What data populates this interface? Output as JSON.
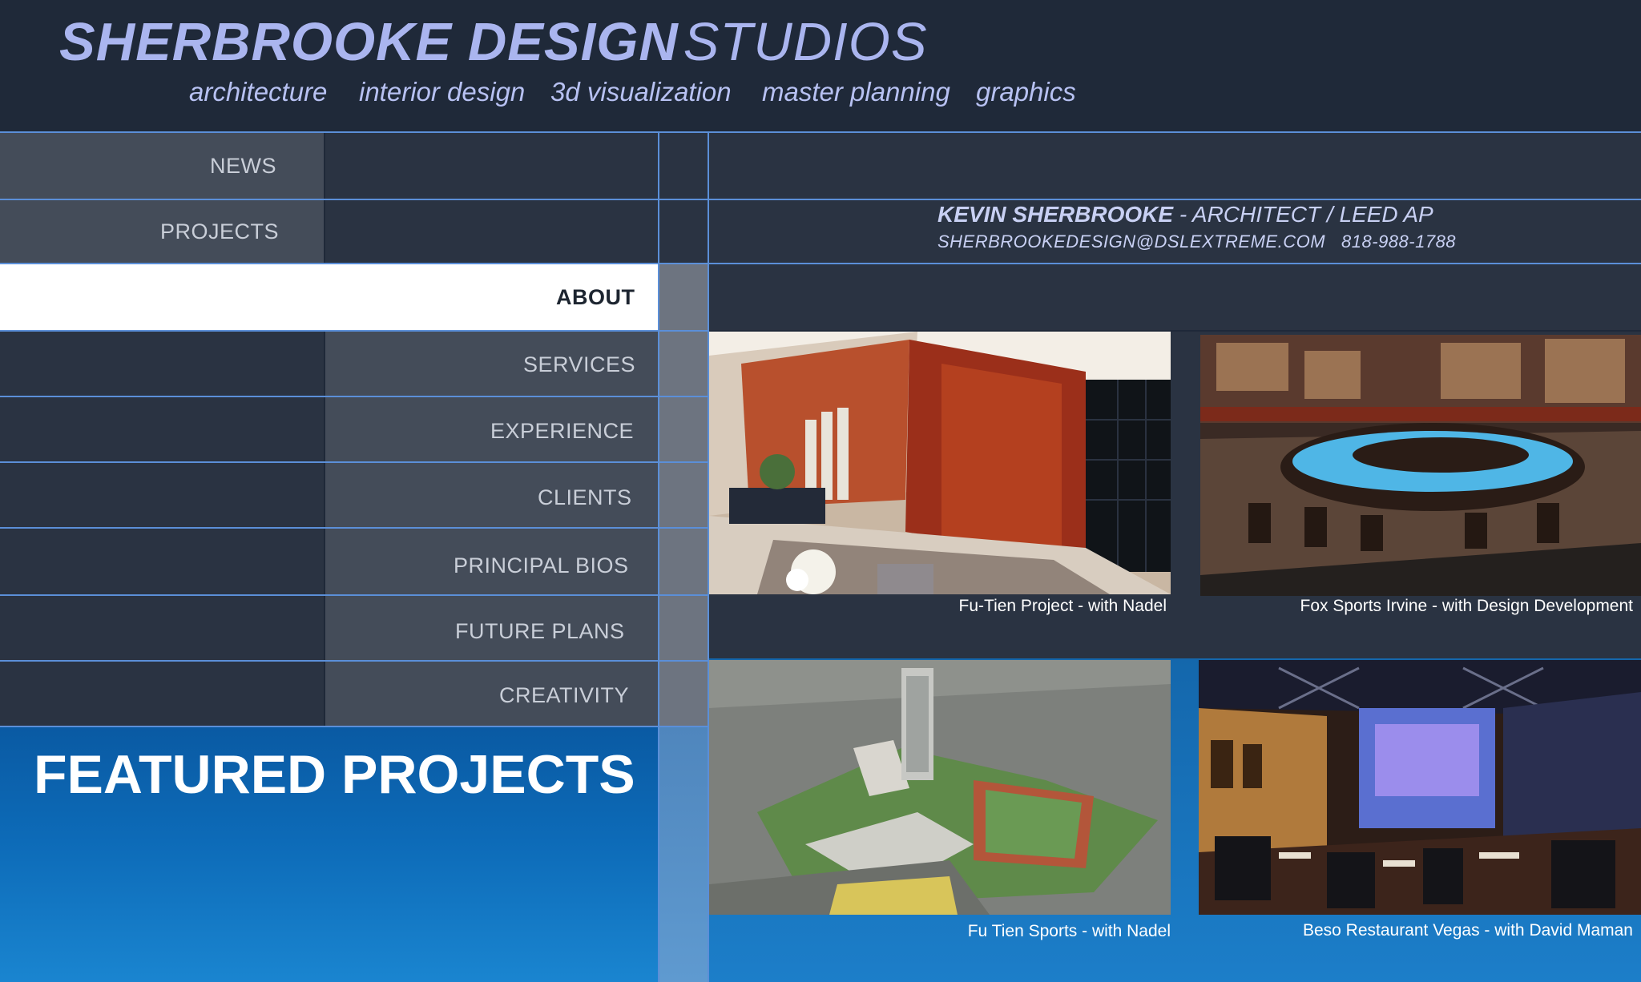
{
  "header": {
    "brand_bold": "SHERBROOKE DESIGN",
    "brand_light": "STUDIOS",
    "services": [
      "architecture",
      "interior design",
      "3d visualization",
      "master planning",
      "graphics"
    ]
  },
  "nav": {
    "items": [
      {
        "label": "NEWS"
      },
      {
        "label": "PROJECTS"
      },
      {
        "label": "ABOUT",
        "active": true
      },
      {
        "label": "SERVICES"
      },
      {
        "label": "EXPERIENCE"
      },
      {
        "label": "CLIENTS"
      },
      {
        "label": "PRINCIPAL BIOS"
      },
      {
        "label": "FUTURE PLANS"
      },
      {
        "label": "CREATIVITY"
      }
    ]
  },
  "contact": {
    "name": "KEVIN SHERBROOKE",
    "title": " - ARCHITECT / LEED AP",
    "email": "SHERBROOKEDESIGN@DSLEXTREME.COM",
    "phone": "818-988-1788"
  },
  "featured": {
    "heading": "FEATURED PROJECTS"
  },
  "gallery": [
    {
      "caption": "Fu-Tien Project - with Nadel"
    },
    {
      "caption": "Fox Sports Irvine - with Design Development"
    },
    {
      "caption": "Fu Tien Sports - with Nadel"
    },
    {
      "caption": "Beso Restaurant Vegas - with David Maman"
    }
  ],
  "colors": {
    "background": "#1f2939",
    "accent_line": "#5b8fd8",
    "brand_text": "#aab5ef",
    "featured_blue": "#0d6bb8"
  }
}
